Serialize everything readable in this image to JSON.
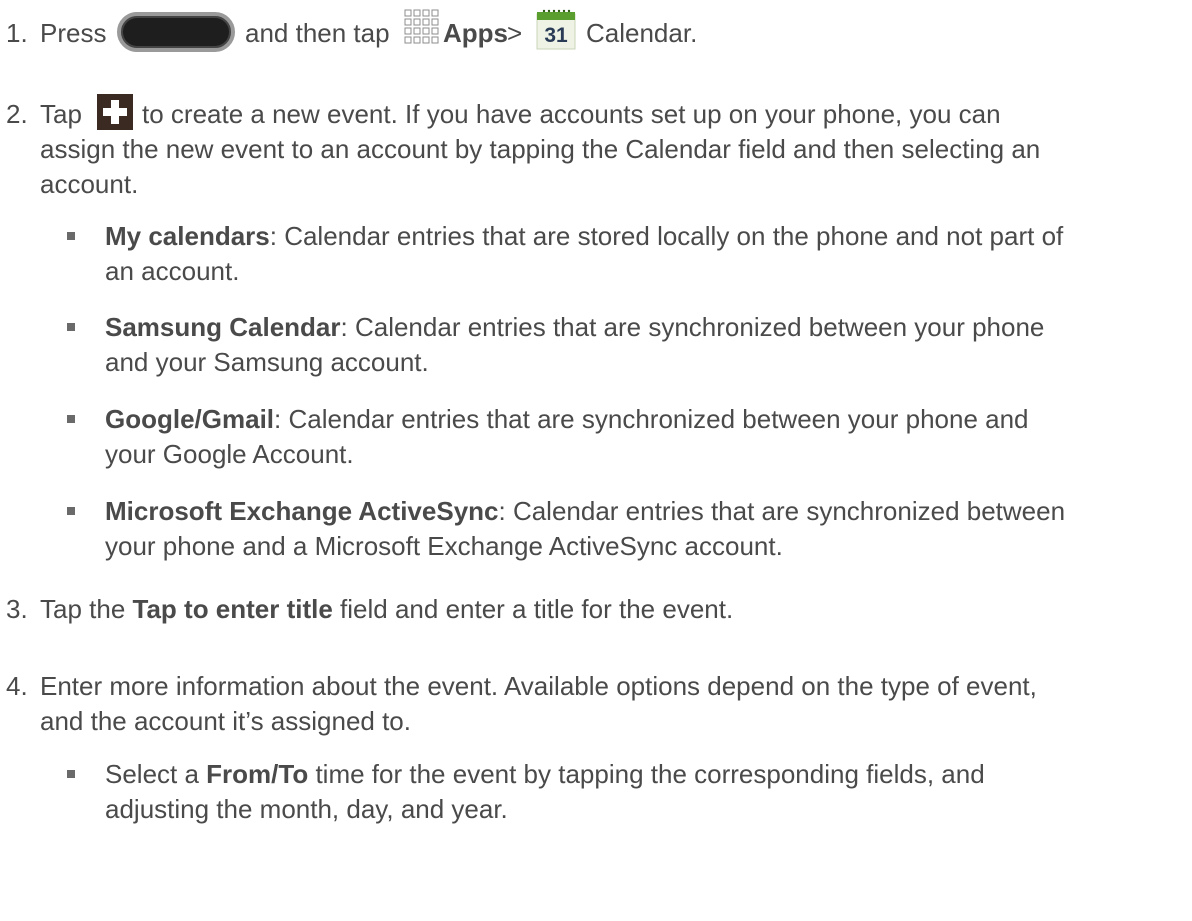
{
  "steps": [
    {
      "number": "1.",
      "press": "Press",
      "and_then_tap": "and then tap",
      "apps": "Apps",
      "sep": ">",
      "calendar": "Calendar.",
      "calendar_day": "31"
    },
    {
      "number": "2.",
      "tap": "Tap",
      "lines": [
        "to create a new event. If you have accounts set up on your phone, you can",
        "assign the new event to an account by tapping the Calendar field and then selecting an",
        "account."
      ],
      "bullets": [
        {
          "bold": "My calendars",
          "line1": ": Calendar entries that are stored locally on the phone and not part of",
          "line2": "an account."
        },
        {
          "bold": "Samsung Calendar",
          "line1": ": Calendar entries that are synchronized between your phone",
          "line2": "and your Samsung account."
        },
        {
          "bold": "Google/Gmail",
          "line1": ": Calendar entries that are synchronized between your phone and",
          "line2": "your Google Account."
        },
        {
          "bold": "Microsoft Exchange ActiveSync",
          "line1": ": Calendar entries that are synchronized between",
          "line2": "your phone and a Microsoft Exchange ActiveSync account."
        }
      ]
    },
    {
      "number": "3.",
      "pre": "Tap the ",
      "bold": "Tap to enter title",
      "post": " field and enter a title for the event."
    },
    {
      "number": "4.",
      "lines": [
        "Enter more information about the event. Available options depend on the type of event,",
        "and the account it’s assigned to."
      ],
      "bullet": {
        "pre": "Select a ",
        "bold": "From/To",
        "post": " time for the event by tapping the corresponding fields, and",
        "line2": "adjusting the month, day, and year."
      }
    }
  ]
}
